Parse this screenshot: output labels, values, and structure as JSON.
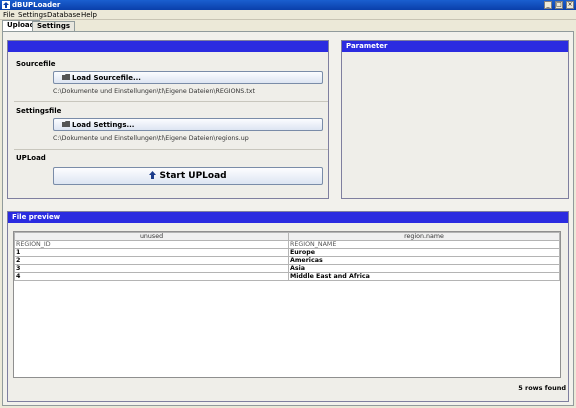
{
  "window": {
    "title": "dBUPLoader",
    "min_glyph": "_",
    "max_glyph": "□",
    "close_glyph": "×"
  },
  "menubar": {
    "items": [
      "File",
      "Settings",
      "Database",
      "Help"
    ]
  },
  "tabs": [
    {
      "label": "Upload",
      "active": true
    },
    {
      "label": "Settings",
      "active": false
    }
  ],
  "upload_panel": {
    "header": "",
    "sourcefile": {
      "label": "Sourcefile",
      "button_label": "Load Sourcefile...",
      "path": "C:\\Dokumente und Einstellungen\\tl\\Eigene Dateien\\REGIONS.txt"
    },
    "settingsfile": {
      "label": "Settingsfile",
      "button_label": "Load Settings...",
      "path": "C:\\Dokumente und Einstellungen\\tl\\Eigene Dateien\\regions.up"
    },
    "upload": {
      "label": "UPLoad",
      "button_label": "Start UPLoad"
    }
  },
  "parameter_panel": {
    "header": "Parameter"
  },
  "preview_panel": {
    "header": "File preview",
    "columns": [
      "unused",
      "region.name"
    ],
    "source_header_row": [
      "REGION_ID",
      "REGION_NAME"
    ],
    "rows": [
      [
        "1",
        "Europe"
      ],
      [
        "2",
        "Americas"
      ],
      [
        "3",
        "Asia"
      ],
      [
        "4",
        "Middle East and Africa"
      ]
    ],
    "row_count_text": "5 rows found"
  },
  "colors": {
    "panel_header": "#2b2be0",
    "title_bar": "#0a3faa"
  },
  "icons": {
    "load_button": "folder-icon",
    "upload_button": "up-arrow-icon"
  }
}
